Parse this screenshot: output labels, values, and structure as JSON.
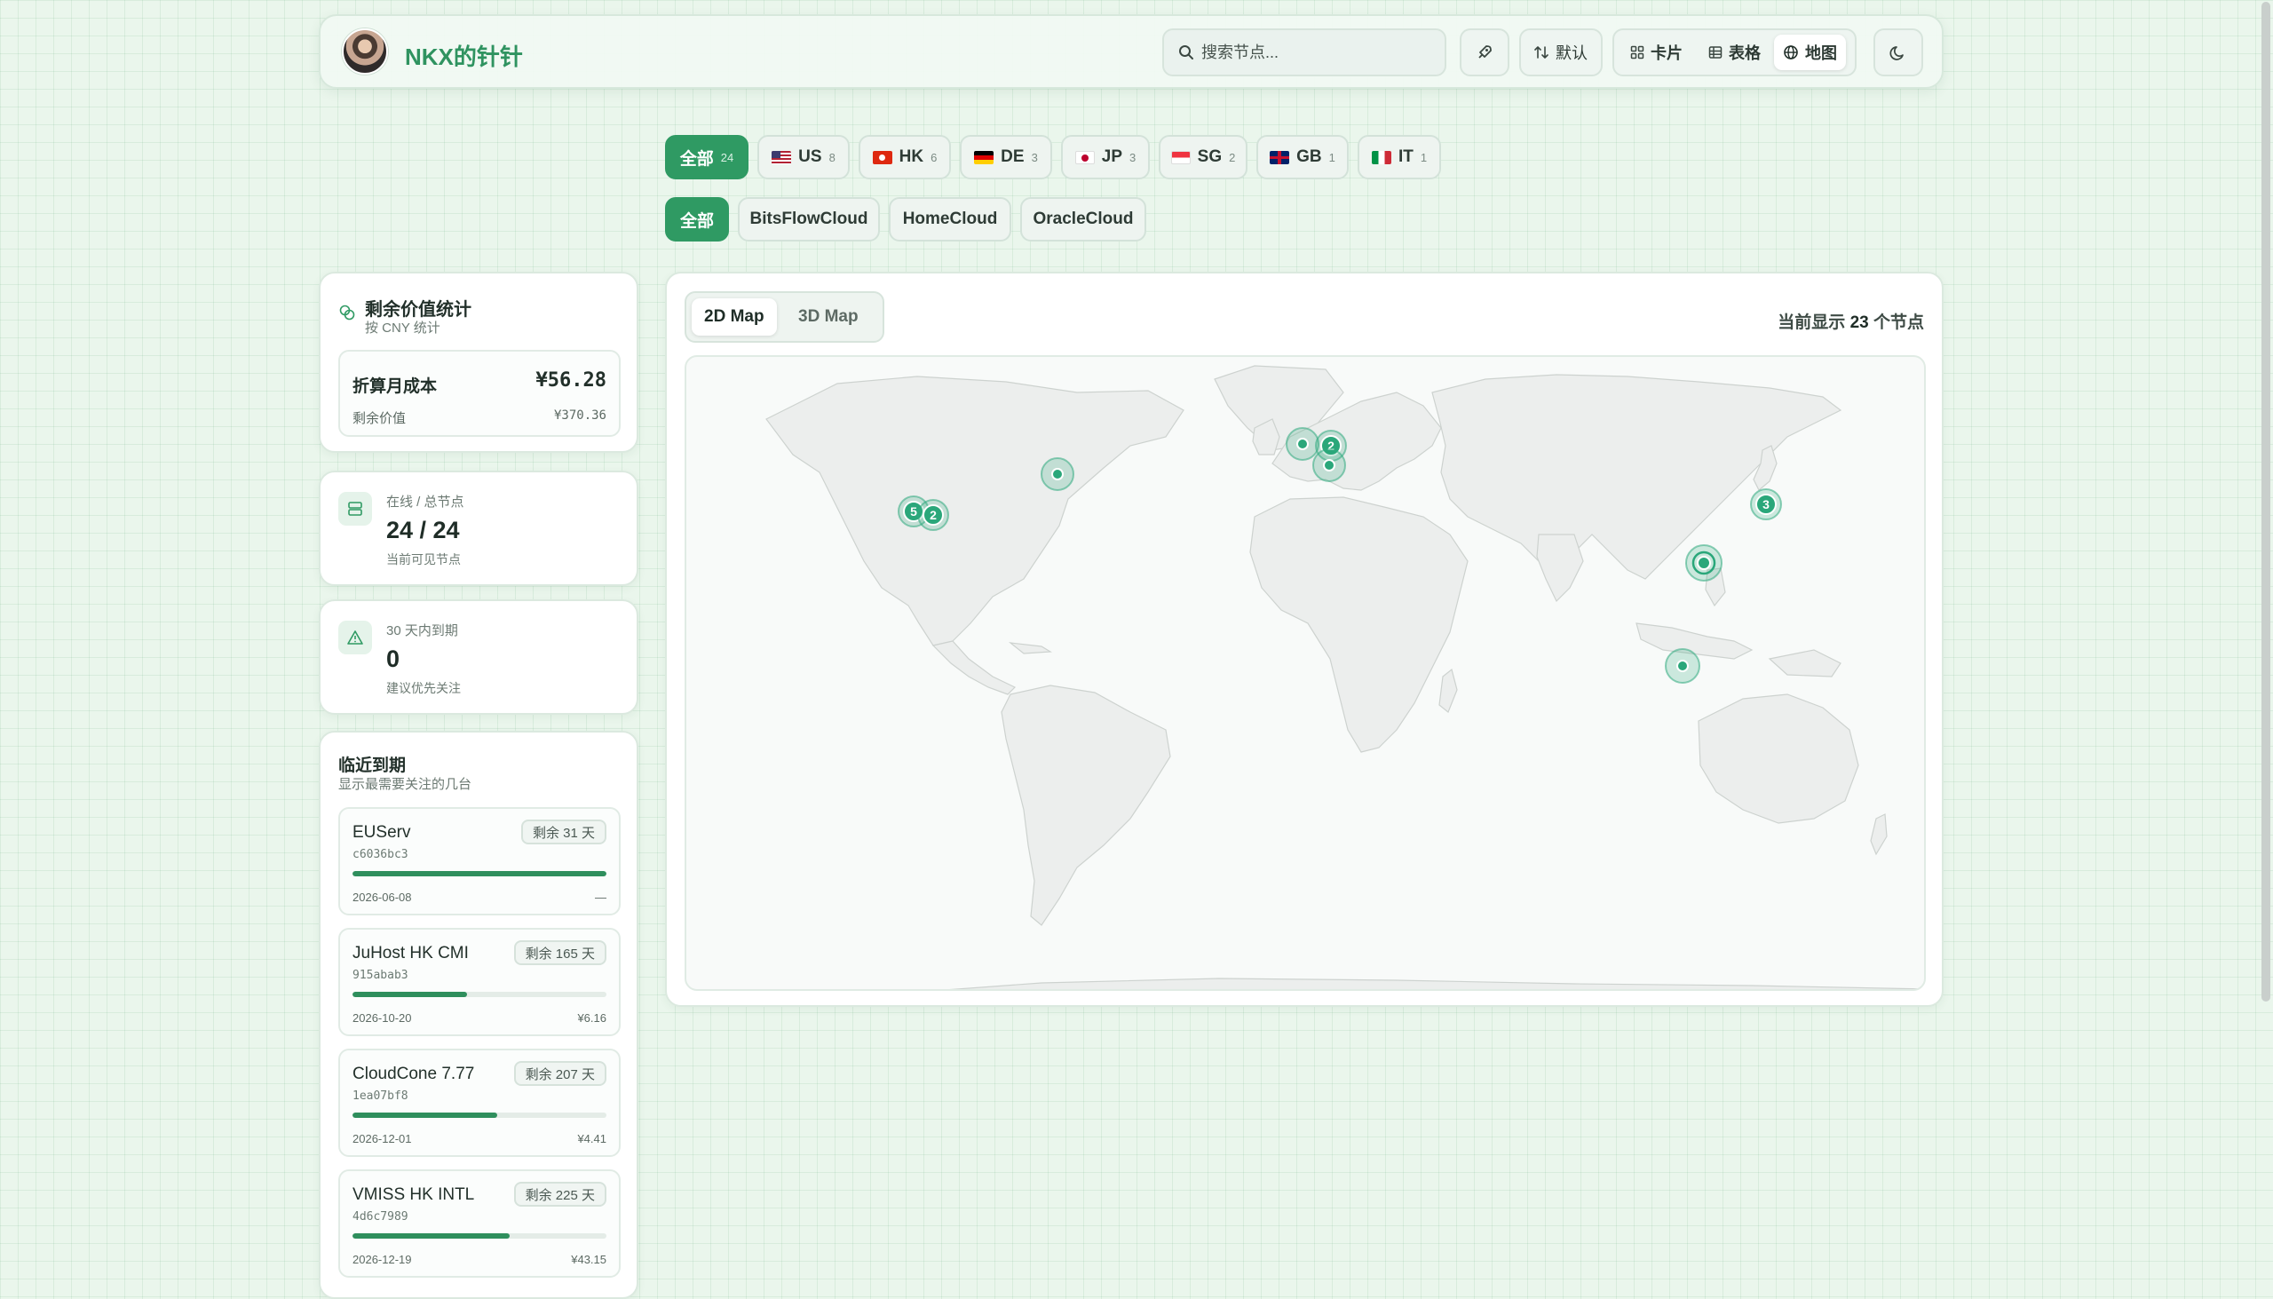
{
  "header": {
    "title": "NKX的针针",
    "search_placeholder": "搜索节点...",
    "sort_label": "默认",
    "views": [
      {
        "label": "卡片",
        "active": false
      },
      {
        "label": "表格",
        "active": false
      },
      {
        "label": "地图",
        "active": true
      }
    ]
  },
  "region_filters": [
    {
      "label": "全部",
      "count": "24",
      "active": true
    },
    {
      "label": "US",
      "count": "8",
      "flag": "us"
    },
    {
      "label": "HK",
      "count": "6",
      "flag": "hk"
    },
    {
      "label": "DE",
      "count": "3",
      "flag": "de"
    },
    {
      "label": "JP",
      "count": "3",
      "flag": "jp"
    },
    {
      "label": "SG",
      "count": "2",
      "flag": "sg"
    },
    {
      "label": "GB",
      "count": "1",
      "flag": "gb"
    },
    {
      "label": "IT",
      "count": "1",
      "flag": "it"
    }
  ],
  "group_filters": [
    {
      "label": "全部",
      "active": true
    },
    {
      "label": "BitsFlowCloud"
    },
    {
      "label": "HomeCloud"
    },
    {
      "label": "OracleCloud"
    }
  ],
  "stats": {
    "value": {
      "title": "剩余价值统计",
      "subtitle": "按 CNY 统计",
      "monthly_label": "折算月成本",
      "monthly_value": "¥56.28",
      "remaining_label": "剩余价值",
      "remaining_value": "¥370.36"
    },
    "online": {
      "label": "在线 / 总节点",
      "value": "24 / 24",
      "note": "当前可见节点"
    },
    "expiring": {
      "label": "30 天内到期",
      "value": "0",
      "note": "建议优先关注"
    }
  },
  "upcoming": {
    "title": "临近到期",
    "subtitle": "显示最需要关注的几台",
    "items": [
      {
        "name": "EUServ",
        "badge": "剩余 31 天",
        "id": "c6036bc3",
        "progress": 1.0,
        "date": "2026-06-08",
        "price": "—"
      },
      {
        "name": "JuHost HK CMI",
        "badge": "剩余 165 天",
        "id": "915abab3",
        "progress": 0.45,
        "date": "2026-10-20",
        "price": "¥6.16"
      },
      {
        "name": "CloudCone 7.77",
        "badge": "剩余 207 天",
        "id": "1ea07bf8",
        "progress": 0.57,
        "date": "2026-12-01",
        "price": "¥4.41"
      },
      {
        "name": "VMISS HK INTL",
        "badge": "剩余 225 天",
        "id": "4d6c7989",
        "progress": 0.62,
        "date": "2026-12-19",
        "price": "¥43.15"
      }
    ]
  },
  "map": {
    "tabs": [
      {
        "label": "2D Map",
        "active": true
      },
      {
        "label": "3D Map",
        "active": false
      }
    ],
    "count_prefix": "当前显示",
    "count_value": "23",
    "count_suffix": "个节点",
    "markers": [
      {
        "location": "us-west",
        "count": "5"
      },
      {
        "location": "us-west-2",
        "count": "2"
      },
      {
        "location": "us-east",
        "count": ""
      },
      {
        "location": "gb",
        "count": ""
      },
      {
        "location": "de",
        "count": "2"
      },
      {
        "location": "eu-south",
        "count": ""
      },
      {
        "location": "jp",
        "count": "3"
      },
      {
        "location": "hk",
        "count": ""
      },
      {
        "location": "sg",
        "count": ""
      }
    ]
  },
  "colors": {
    "accent": "#2f9a63",
    "marker": "#2aa77a",
    "title": "#2f9360"
  }
}
